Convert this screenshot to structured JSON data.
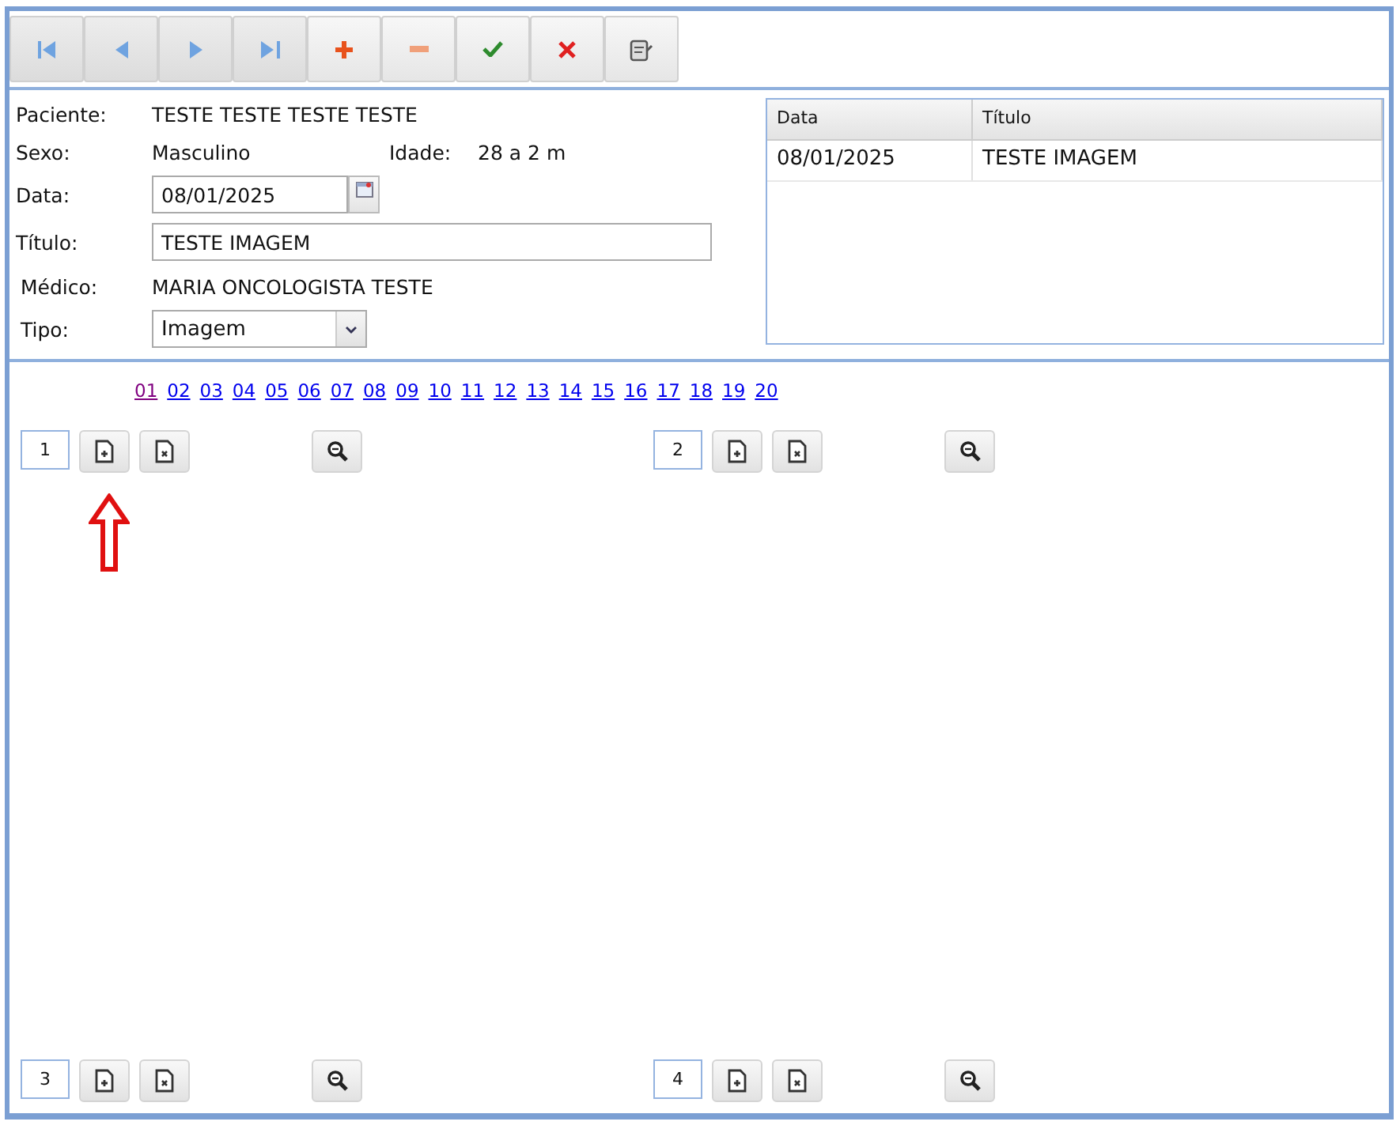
{
  "toolbar": [
    {
      "kind": "first"
    },
    {
      "kind": "previous"
    },
    {
      "kind": "next"
    },
    {
      "kind": "last"
    },
    {
      "kind": "add"
    },
    {
      "kind": "remove"
    },
    {
      "kind": "confirm"
    },
    {
      "kind": "cancel"
    },
    {
      "kind": "report"
    }
  ],
  "form": {
    "patient_label": "Paciente:",
    "patient": "TESTE TESTE TESTE TESTE",
    "sex_label": "Sexo:",
    "sex": "Masculino",
    "age_label": "Idade:",
    "age": "28 a 2 m",
    "date_label": "Data:",
    "date": "08/01/2025",
    "title_label": "Título:",
    "title": "TESTE IMAGEM",
    "doctor_label": "Médico:",
    "doctor": "MARIA ONCOLOGISTA TESTE",
    "type_label": "Tipo:",
    "type": "Imagem"
  },
  "table": {
    "columns": [
      "Data",
      "Título"
    ],
    "rows": [
      [
        "08/01/2025",
        "TESTE IMAGEM"
      ]
    ]
  },
  "pages": [
    {
      "label": "01",
      "visited": true
    },
    {
      "label": "02",
      "visited": false
    },
    {
      "label": "03",
      "visited": false
    },
    {
      "label": "04",
      "visited": false
    },
    {
      "label": "05",
      "visited": false
    },
    {
      "label": "06",
      "visited": false
    },
    {
      "label": "07",
      "visited": false
    },
    {
      "label": "08",
      "visited": false
    },
    {
      "label": "09",
      "visited": false
    },
    {
      "label": "10",
      "visited": false
    },
    {
      "label": "11",
      "visited": false
    },
    {
      "label": "12",
      "visited": false
    },
    {
      "label": "13",
      "visited": false
    },
    {
      "label": "14",
      "visited": false
    },
    {
      "label": "15",
      "visited": false
    },
    {
      "label": "16",
      "visited": false
    },
    {
      "label": "17",
      "visited": false
    },
    {
      "label": "18",
      "visited": false
    },
    {
      "label": "19",
      "visited": false
    },
    {
      "label": "20",
      "visited": false
    }
  ],
  "slots": [
    {
      "number": "1"
    },
    {
      "number": "2"
    },
    {
      "number": "3"
    },
    {
      "number": "4"
    }
  ]
}
